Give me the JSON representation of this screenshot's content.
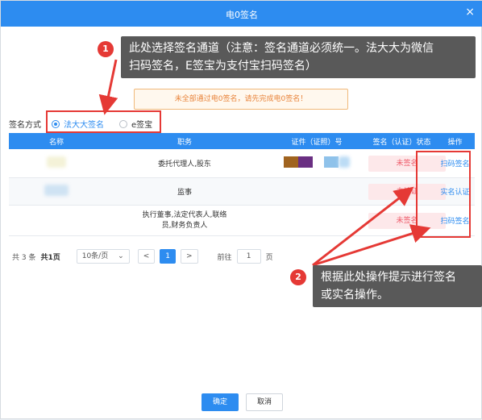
{
  "dialog": {
    "title": "电0签名",
    "close_glyph": "×"
  },
  "hint": "未全部通过电0签名，请先完成电0签名！",
  "sign_method": {
    "label": "签名方式",
    "options": [
      "法大大签名",
      "e签宝"
    ],
    "selected": "法大大签名"
  },
  "table": {
    "headers": [
      "名称",
      "职务",
      "证件（证照）号",
      "签名（认证）状态",
      "操作"
    ],
    "rows": [
      {
        "position": "委托代理人,股东",
        "status": "未签名",
        "action": "扫码签名"
      },
      {
        "position": "监事",
        "status": "未认证",
        "action": "实名认证"
      },
      {
        "position_line1": "执行董事,法定代表人,联络",
        "position_line2": "员,财务负责人",
        "status": "未签名",
        "action": "扫码签名"
      }
    ]
  },
  "pager": {
    "total": "共 3 条",
    "pages": "共1页",
    "page_size": "10条/页",
    "prev": "<",
    "current": "1",
    "next": ">",
    "goto_label": "前往",
    "goto_value": "1",
    "goto_suffix": "页"
  },
  "callouts": {
    "one_badge": "1",
    "one_text_line1": "此处选择签名通道（注意：签名通道必须统一。法大大为微信",
    "one_text_line2": "扫码签名，E签宝为支付宝扫码签名）",
    "two_badge": "2",
    "two_text_line1": "根据此处操作提示进行签名",
    "two_text_line2": "或实名操作。"
  },
  "buttons": {
    "ok": "确定",
    "cancel": "取消"
  },
  "colors": {
    "primary": "#2d8cf0",
    "danger": "#e53935",
    "status_text": "#ee5b6a",
    "callout_bg": "#595959"
  }
}
